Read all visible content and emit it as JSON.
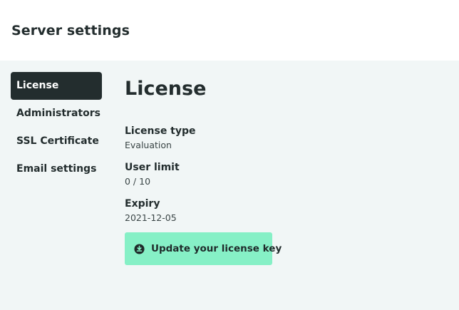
{
  "header": {
    "title": "Server settings"
  },
  "sidebar": {
    "items": [
      {
        "label": "License",
        "active": true
      },
      {
        "label": "Administrators",
        "active": false
      },
      {
        "label": "SSL Certificate",
        "active": false
      },
      {
        "label": "Email settings",
        "active": false
      }
    ]
  },
  "main": {
    "title": "License",
    "fields": [
      {
        "label": "License type",
        "value": "Evaluation"
      },
      {
        "label": "User limit",
        "value": "0 / 10"
      },
      {
        "label": "Expiry",
        "value": "2021-12-05"
      }
    ],
    "update_button": {
      "label": "Update your license key",
      "icon": "download-icon"
    }
  },
  "colors": {
    "active_nav_bg": "#232d2e",
    "button_bg": "#86f0c6",
    "content_bg": "#f1f6f6"
  }
}
